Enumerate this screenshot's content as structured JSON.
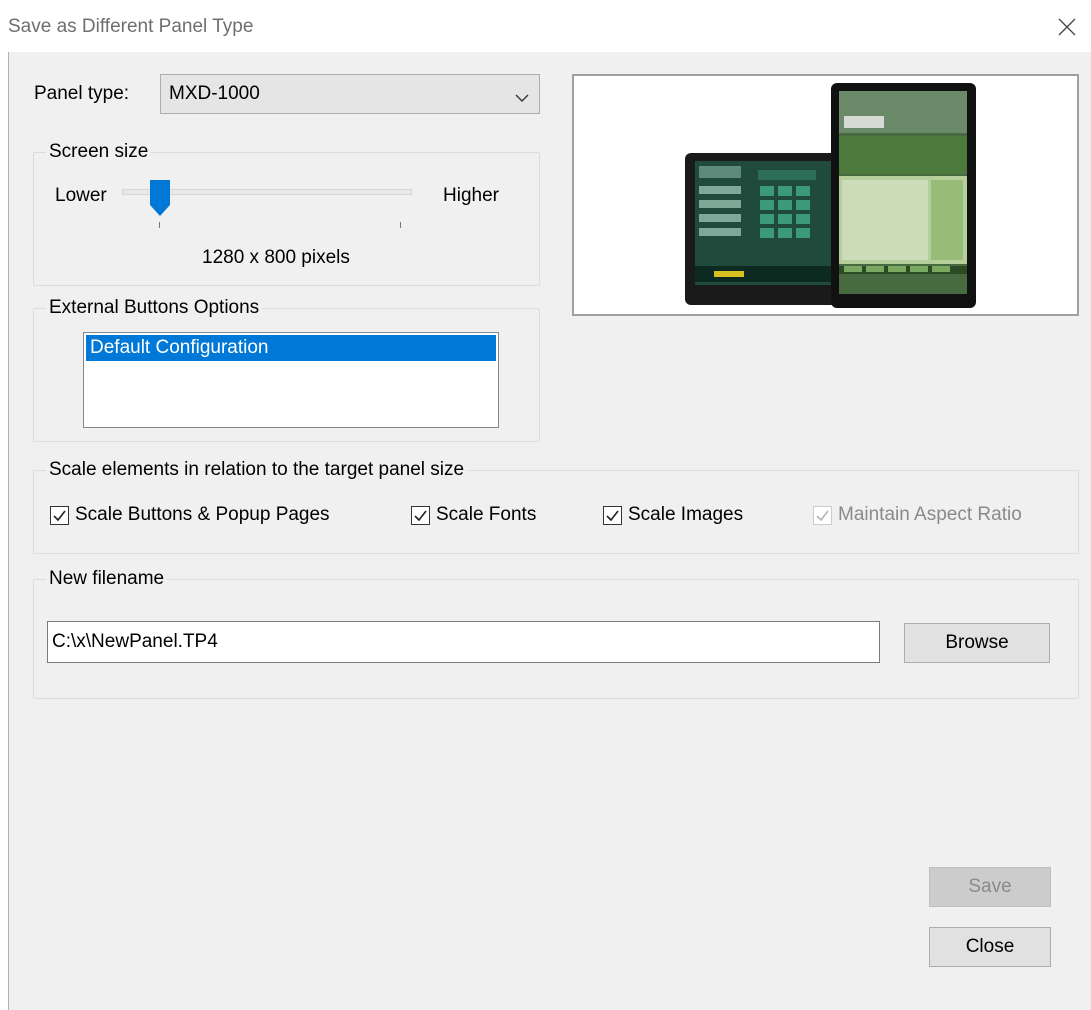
{
  "window": {
    "title": "Save as Different Panel Type",
    "close_icon": "close-icon"
  },
  "panel_type": {
    "label": "Panel type:",
    "selected": "MXD-1000"
  },
  "screen_size": {
    "legend": "Screen size",
    "lower_label": "Lower",
    "higher_label": "Higher",
    "resolution": "1280 x 800 pixels",
    "slider_position": 0
  },
  "external_buttons": {
    "legend": "External Buttons Options",
    "options": [
      "Default Configuration"
    ],
    "selected_index": 0
  },
  "scale": {
    "legend": "Scale elements in relation to the target panel size",
    "options": [
      {
        "label": "Scale Buttons & Popup Pages",
        "checked": true,
        "enabled": true
      },
      {
        "label": "Scale Fonts",
        "checked": true,
        "enabled": true
      },
      {
        "label": "Scale Images",
        "checked": true,
        "enabled": true
      },
      {
        "label": "Maintain Aspect Ratio",
        "checked": true,
        "enabled": false
      }
    ]
  },
  "filename": {
    "legend": "New filename",
    "value": "C:\\x\\NewPanel.TP4",
    "browse_label": "Browse"
  },
  "buttons": {
    "save_label": "Save",
    "close_label": "Close"
  },
  "colors": {
    "accent": "#0078d7",
    "dialog_bg": "#f0f0f0",
    "disabled_text": "#8a8a8a"
  }
}
